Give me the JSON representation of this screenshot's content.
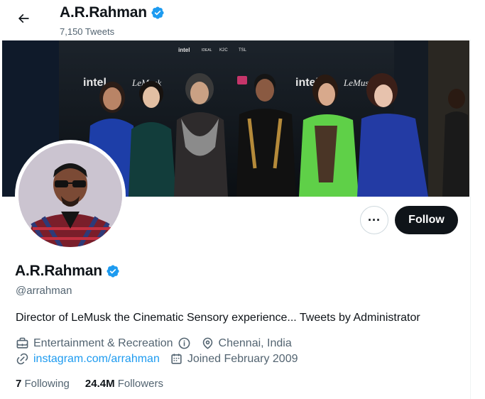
{
  "header": {
    "name": "A.R.Rahman",
    "tweet_count": "7,150 Tweets"
  },
  "banner": {
    "logos": [
      "intel",
      "IDEAL",
      "K2C",
      "TSL",
      "intel",
      "LeMusk",
      "intel",
      "LeMusk"
    ]
  },
  "profile": {
    "name": "A.R.Rahman",
    "handle": "@arrahman",
    "bio": "Director of LeMusk the Cinematic Sensory experience... Tweets by Administrator",
    "category": "Entertainment & Recreation",
    "location": "Chennai, India",
    "website": "instagram.com/arrahman",
    "joined": "Joined February 2009"
  },
  "actions": {
    "more_label": "···",
    "follow_label": "Follow"
  },
  "stats": {
    "following_count": "7",
    "following_label": "Following",
    "followers_count": "24.4M",
    "followers_label": "Followers"
  },
  "colors": {
    "accent": "#1d9bf0",
    "text": "#0f1419",
    "secondary": "#536471",
    "follow_bg": "#0f1419"
  }
}
